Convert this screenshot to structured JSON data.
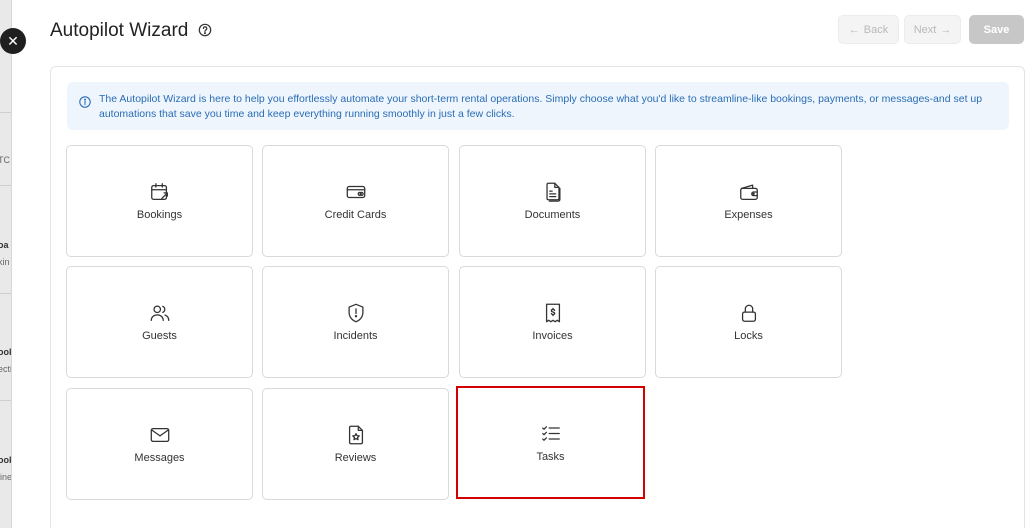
{
  "header": {
    "title": "Autopilot Wizard",
    "back_label": "Back",
    "next_label": "Next",
    "save_label": "Save"
  },
  "info_banner": {
    "text": "The Autopilot Wizard is here to help you effortlessly automate your short-term rental operations. Simply choose what you'd like to streamline-like bookings, payments, or messages-and set up automations that save you time and keep everything running smoothly in just a few clicks."
  },
  "background_fragments": [
    "TC",
    "oa",
    "kin",
    "ook",
    "ecti",
    "ook",
    "line"
  ],
  "cards": [
    {
      "label": "Bookings",
      "icon": "calendar-arrow-icon"
    },
    {
      "label": "Credit Cards",
      "icon": "credit-card-icon"
    },
    {
      "label": "Documents",
      "icon": "documents-icon"
    },
    {
      "label": "Expenses",
      "icon": "wallet-icon"
    },
    {
      "label": "Guests",
      "icon": "users-icon"
    },
    {
      "label": "Incidents",
      "icon": "shield-alert-icon"
    },
    {
      "label": "Invoices",
      "icon": "receipt-dollar-icon"
    },
    {
      "label": "Locks",
      "icon": "lock-icon"
    },
    {
      "label": "Messages",
      "icon": "envelope-icon"
    },
    {
      "label": "Reviews",
      "icon": "file-star-icon"
    },
    {
      "label": "Tasks",
      "icon": "checklist-icon",
      "selected": true
    }
  ],
  "colors": {
    "accent_info": "#2a6db5",
    "selected_border": "#d40000",
    "save_button": "#c7c7c7"
  }
}
